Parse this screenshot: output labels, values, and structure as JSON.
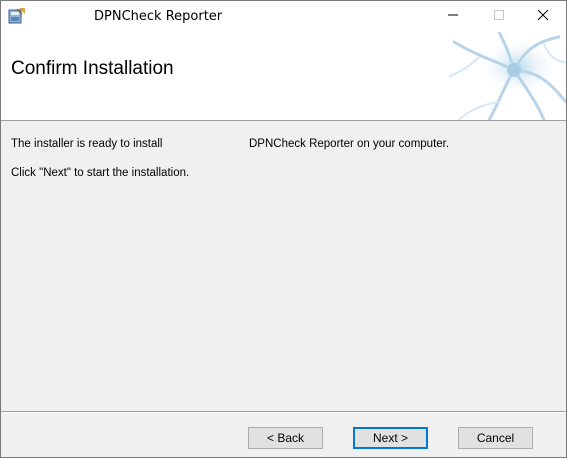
{
  "window": {
    "title": "DPNCheck Reporter",
    "minimize_icon": "minimize-icon",
    "maximize_icon": "maximize-icon",
    "close_icon": "close-icon",
    "app_icon": "installer-icon"
  },
  "header": {
    "title": "Confirm Installation",
    "banner_icon": "neuron-banner-art"
  },
  "body": {
    "line1_part1": "The installer is ready to install",
    "line1_part2": "DPNCheck Reporter on your computer.",
    "line2": "Click \"Next\" to start the installation."
  },
  "buttons": {
    "back": "< Back",
    "next": "Next >",
    "cancel": "Cancel"
  },
  "colors": {
    "focus_border": "#0078d7",
    "dialog_bg": "#f0f0f0"
  }
}
